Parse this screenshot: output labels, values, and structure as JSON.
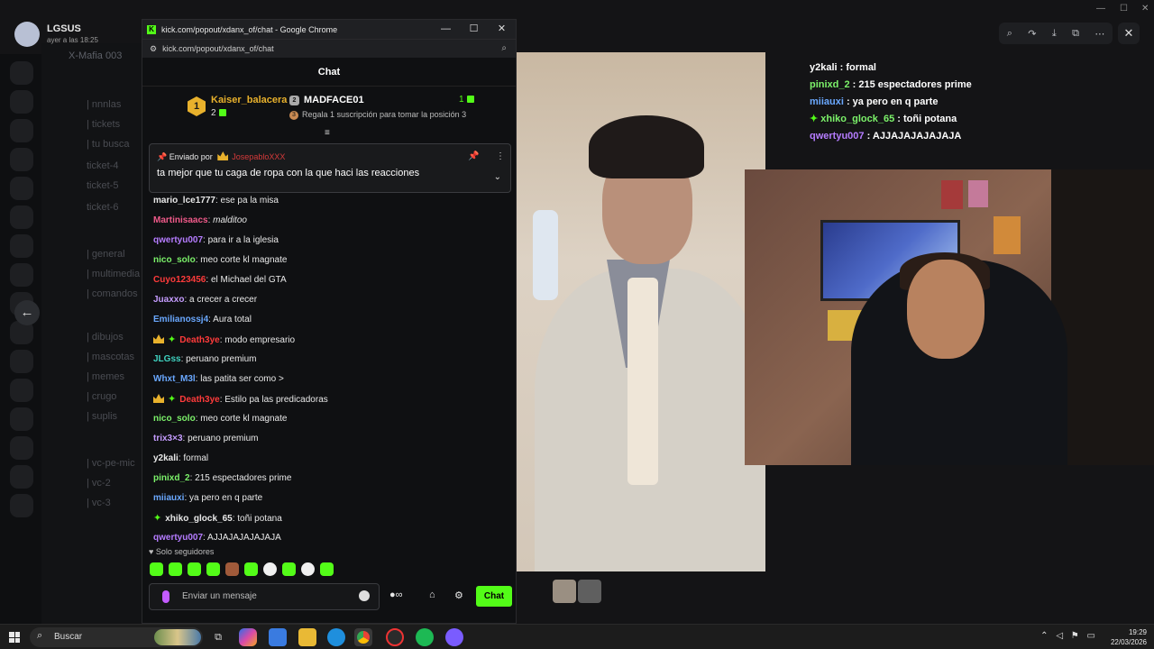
{
  "background_app": {
    "user_name": "LGSUS",
    "user_subtitle": "ayer a las 18:25",
    "channels": [
      "X-Mafia 003",
      "| nnnlas",
      "| tickets",
      "| tu busca",
      "ticket-4",
      "ticket-5",
      "ticket-6",
      "| general",
      "| multimedia",
      "| comandos",
      "| dibujos",
      "| mascotas",
      "| memes",
      "| crugo",
      "| suplis",
      "| vc-pe-mic",
      "| vc-2",
      "| vc-3"
    ],
    "viewer_tools": [
      "zoom-in-icon",
      "reply-icon",
      "download-icon",
      "open-external-icon",
      "more-icon"
    ]
  },
  "popout": {
    "window_title": "kick.com/popout/xdanx_of/chat - Google Chrome",
    "url": "kick.com/popout/xdanx_of/chat",
    "chat_header": "Chat",
    "leaderboard": {
      "first_rank": "1",
      "first_name": "Kaiser_balacera",
      "first_count": "2",
      "second_rank": "2",
      "second_name": "MADFACE01",
      "second_count": "1",
      "third_rank": "3",
      "third_text": "Regala 1 suscripción para tomar la posición 3"
    },
    "pinned": {
      "label": "Enviado por",
      "user": "JosepabloXXX",
      "message": "ta mejor que tu caga de ropa con la que haci las reacciones"
    },
    "messages": [
      {
        "user": "mario_lce1777",
        "color": "#e8e8e8",
        "text": "ese pa la misa",
        "crown": false,
        "star": false
      },
      {
        "user": "Martinisaacs",
        "color": "#f05a8a",
        "text": "malditoo",
        "crown": false,
        "star": false
      },
      {
        "user": "qwertyu007",
        "color": "#b57cff",
        "text": "para ir a la iglesia",
        "crown": false,
        "star": false
      },
      {
        "user": "nico_solo",
        "color": "#7cf26a",
        "text": "meo corte kl magnate",
        "crown": false,
        "star": false
      },
      {
        "user": "Cuyo123456",
        "color": "#ff3b3b",
        "text": "el Michael del GTA",
        "crown": false,
        "star": false
      },
      {
        "user": "Juaxxo",
        "color": "#c59cff",
        "text": "a crecer a crecer",
        "crown": false,
        "star": false
      },
      {
        "user": "Emilianossj4",
        "color": "#6aa8ff",
        "text": "Aura total",
        "crown": false,
        "star": false
      },
      {
        "user": "Death3ye",
        "color": "#ff3b3b",
        "text": "modo empresario",
        "crown": true,
        "star": true
      },
      {
        "user": "JLGss",
        "color": "#3fd2c0",
        "text": "peruano premium",
        "crown": false,
        "star": false
      },
      {
        "user": "Whxt_M3l",
        "color": "#6aa8ff",
        "text": "las patita ser como >",
        "crown": false,
        "star": false
      },
      {
        "user": "Death3ye",
        "color": "#ff3b3b",
        "text": "Estilo pa las predicadoras",
        "crown": true,
        "star": true
      },
      {
        "user": "nico_solo",
        "color": "#7cf26a",
        "text": "meo corte kl magnate",
        "crown": false,
        "star": false
      },
      {
        "user": "trix3×3",
        "color": "#c59cff",
        "text": "peruano premium",
        "crown": false,
        "star": false
      },
      {
        "user": "y2kali",
        "color": "#e8e8e8",
        "text": "formal",
        "crown": false,
        "star": false
      },
      {
        "user": "pinixd_2",
        "color": "#7cf26a",
        "text": "215 espectadores prime",
        "crown": false,
        "star": false
      },
      {
        "user": "miiauxi",
        "color": "#6aa8ff",
        "text": "ya pero en q parte",
        "crown": false,
        "star": false
      },
      {
        "user": "xhiko_glock_65",
        "color": "#e8e8e8",
        "text": "toñi potana",
        "crown": false,
        "star": true
      },
      {
        "user": "qwertyu007",
        "color": "#b57cff",
        "text": "AJJAJAJAJAJAJA",
        "crown": false,
        "star": false
      }
    ],
    "followers_only": "Solo seguidores",
    "input_placeholder": "Enviar un mensaje",
    "chat_button": "Chat"
  },
  "overlay_chat": [
    {
      "user": "y2kali",
      "color": "#ffffff",
      "text": "formal"
    },
    {
      "user": "pinixd_2",
      "color": "#7cf26a",
      "text": "215 espectadores prime"
    },
    {
      "user": "miiauxi",
      "color": "#6aa8ff",
      "text": "ya pero en q parte"
    },
    {
      "user": "xhiko_glock_65",
      "color": "#7cf26a",
      "text": "toñi potana"
    },
    {
      "user": "qwertyu007",
      "color": "#b57cff",
      "text": "AJJAJAJAJAJAJA"
    }
  ],
  "taskbar": {
    "search_label": "Buscar",
    "time": "19:29",
    "date": "22/03/2026"
  }
}
